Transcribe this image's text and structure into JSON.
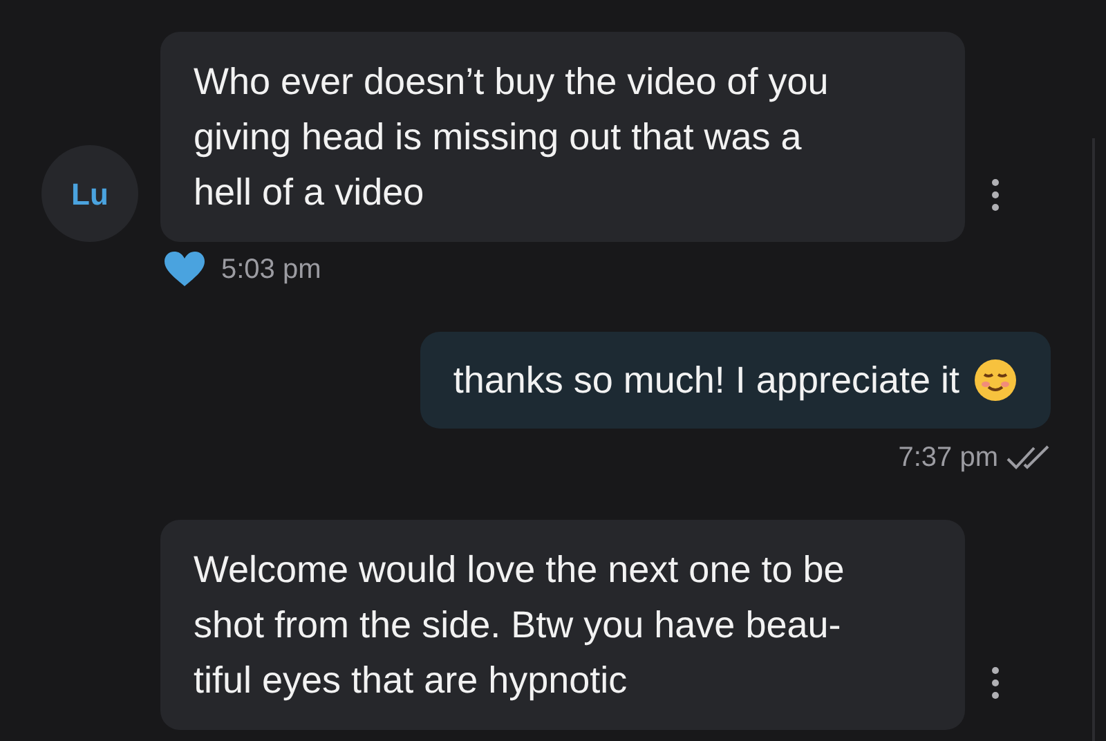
{
  "messages": [
    {
      "kind": "incoming",
      "avatar": "Lu",
      "lines": [
        "Who ever doesn’t buy the video of you",
        "giving head is missing out that was a",
        "hell of a video"
      ],
      "liked": true,
      "time": "5:03 pm"
    },
    {
      "kind": "outgoing",
      "lines": [
        "thanks so much! I appreciate it"
      ],
      "emoji": true,
      "time": "7:37 pm",
      "read": true
    },
    {
      "kind": "incoming",
      "lines": [
        "Welcome would love the next one to be",
        "shot from the side. Btw you have beau-",
        "tiful eyes that are hypnotic"
      ]
    }
  ]
}
